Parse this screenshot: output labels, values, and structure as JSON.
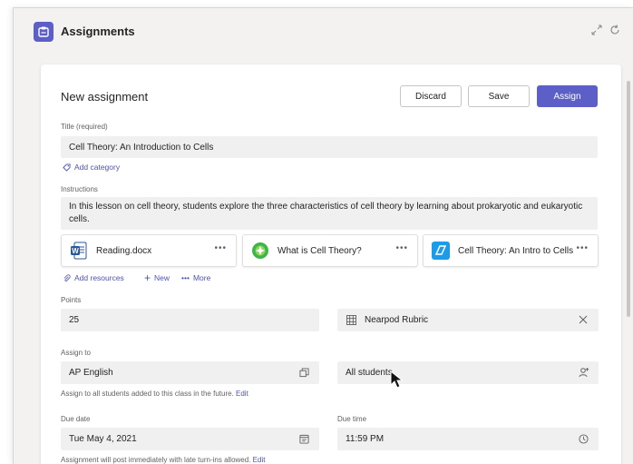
{
  "app": {
    "title": "Assignments"
  },
  "form": {
    "heading": "New assignment",
    "buttons": {
      "discard": "Discard",
      "save": "Save",
      "assign": "Assign"
    },
    "title_label": "Title (required)",
    "title_value": "Cell Theory: An Introduction to Cells",
    "add_category": "Add category",
    "instructions_label": "Instructions",
    "instructions_value": "In this lesson on cell theory, students explore the three characteristics of cell theory by learning about prokaryotic and eukaryotic cells.",
    "attachments": [
      {
        "name": "Reading.docx",
        "icon": "word-doc-icon"
      },
      {
        "name": "What is Cell Theory?",
        "icon": "green-app-icon"
      },
      {
        "name": "Cell Theory: An Intro to Cells",
        "icon": "blue-app-icon"
      }
    ],
    "resource_links": {
      "add_resources": "Add resources",
      "new": "New",
      "more": "More"
    },
    "points_label": "Points",
    "points_value": "25",
    "rubric_value": "Nearpod Rubric",
    "assign_to_label": "Assign to",
    "class_value": "AP English",
    "students_value": "All students",
    "assign_helper": "Assign to all students added to this class in the future.",
    "edit_label": "Edit",
    "due_date_label": "Due date",
    "due_date_value": "Tue May 4, 2021",
    "due_time_label": "Due time",
    "due_time_value": "11:59 PM",
    "post_helper": "Assignment will post immediately with late turn-ins allowed."
  },
  "colors": {
    "accent": "#5b5fc7",
    "link": "#4f52b2",
    "field_bg": "#f0f0f0"
  }
}
